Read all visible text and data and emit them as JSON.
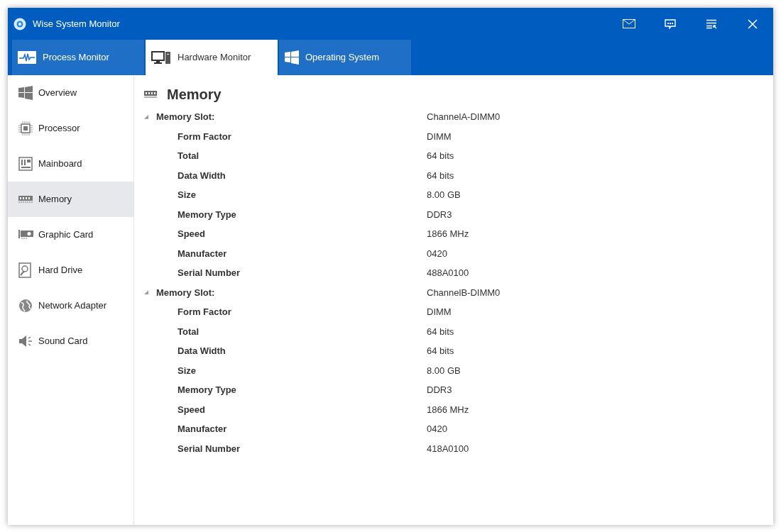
{
  "window": {
    "title": "Wise System Monitor"
  },
  "tabs": [
    {
      "label": "Process Monitor",
      "selected": false
    },
    {
      "label": "Hardware Monitor",
      "selected": true
    },
    {
      "label": "Operating System",
      "selected": false
    }
  ],
  "sidebar": {
    "items": [
      {
        "label": "Overview",
        "selected": false
      },
      {
        "label": "Processor",
        "selected": false
      },
      {
        "label": "Mainboard",
        "selected": false
      },
      {
        "label": "Memory",
        "selected": true
      },
      {
        "label": "Graphic Card",
        "selected": false
      },
      {
        "label": "Hard Drive",
        "selected": false
      },
      {
        "label": "Network Adapter",
        "selected": false
      },
      {
        "label": "Sound Card",
        "selected": false
      }
    ]
  },
  "content": {
    "heading": "Memory",
    "slots": [
      {
        "label": "Memory Slot:",
        "value": "ChannelA-DIMM0",
        "expanded": true,
        "children": [
          {
            "label": "Form Factor",
            "value": "DIMM"
          },
          {
            "label": "Total",
            "value": "64 bits"
          },
          {
            "label": "Data Width",
            "value": "64 bits"
          },
          {
            "label": "Size",
            "value": "8.00 GB"
          },
          {
            "label": "Memory Type",
            "value": "DDR3"
          },
          {
            "label": "Speed",
            "value": "1866 MHz"
          },
          {
            "label": "Manufacter",
            "value": "0420"
          },
          {
            "label": "Serial Number",
            "value": "488A0100"
          }
        ]
      },
      {
        "label": "Memory Slot:",
        "value": "ChannelB-DIMM0",
        "expanded": true,
        "children": [
          {
            "label": "Form Factor",
            "value": "DIMM"
          },
          {
            "label": "Total",
            "value": "64 bits"
          },
          {
            "label": "Data Width",
            "value": "64 bits"
          },
          {
            "label": "Size",
            "value": "8.00 GB"
          },
          {
            "label": "Memory Type",
            "value": "DDR3"
          },
          {
            "label": "Speed",
            "value": "1866 MHz"
          },
          {
            "label": "Manufacter",
            "value": "0420"
          },
          {
            "label": "Serial Number",
            "value": "418A0100"
          }
        ]
      }
    ]
  }
}
